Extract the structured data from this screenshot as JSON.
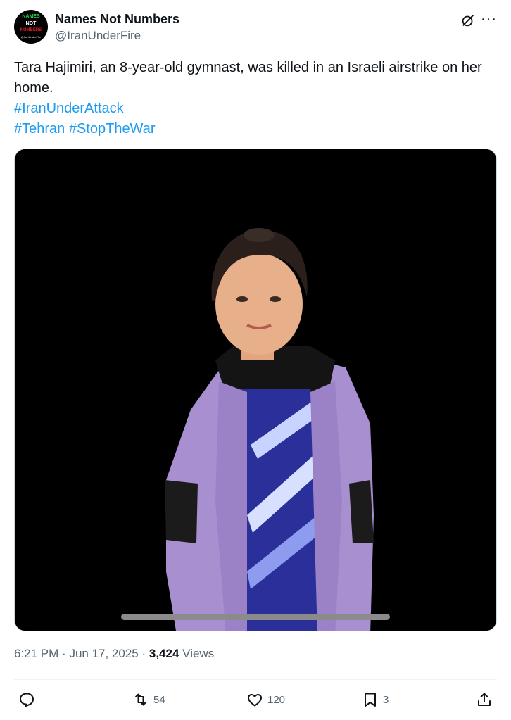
{
  "author": {
    "display_name": "Names Not Numbers",
    "handle": "@IranUnderFire",
    "avatar_lines": [
      "NAMES",
      "NOT",
      "NUMBERS",
      "@IranUnderFire"
    ]
  },
  "tweet": {
    "text": "Tara Hajimiri, an 8-year-old gymnast, was killed in an Israeli airstrike on her home.",
    "hashtags_line1": "#IranUnderAttack",
    "hashtags_line2": "#Tehran #StopTheWar"
  },
  "meta": {
    "time": "6:21 PM",
    "date": "Jun 17, 2025",
    "views_count": "3,424",
    "views_label": "Views"
  },
  "actions": {
    "reply": "",
    "retweets": "54",
    "likes": "120",
    "bookmarks": "3"
  },
  "icons": [
    "grok-icon",
    "more-icon",
    "reply-icon",
    "retweet-icon",
    "like-icon",
    "bookmark-icon",
    "share-icon"
  ],
  "colors": {
    "link": "#1d9bf0",
    "muted": "#536471",
    "text": "#0f1419"
  }
}
